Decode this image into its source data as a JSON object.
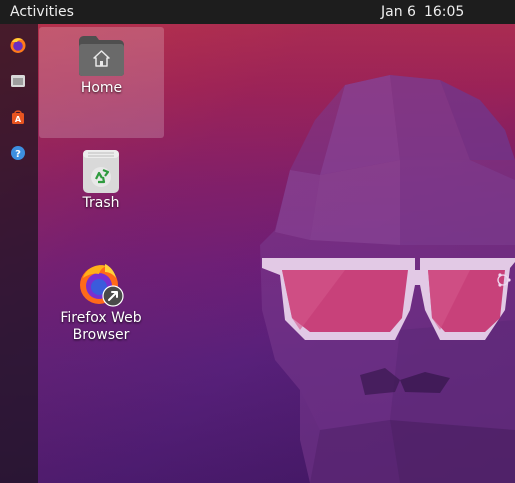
{
  "top_bar": {
    "activities_label": "Activities",
    "date": "Jan 6",
    "time": "16:05"
  },
  "dock": {
    "items": [
      {
        "icon": "firefox-icon"
      },
      {
        "icon": "files-icon"
      },
      {
        "icon": "software-center-icon"
      },
      {
        "icon": "help-icon"
      }
    ]
  },
  "desktop": {
    "icons": [
      {
        "label": "Home",
        "icon": "home-folder-icon",
        "selected": true
      },
      {
        "label": "Trash",
        "icon": "trash-icon",
        "selected": false
      },
      {
        "label": "Firefox Web Browser",
        "icon": "firefox-icon",
        "selected": false
      }
    ]
  },
  "colors": {
    "top_bar": "#1d1d1d",
    "dock": "#1c141e",
    "wallpaper_top": "#b0304f",
    "wallpaper_bottom": "#4b1b6e",
    "glasses": "#c8417a",
    "ubuntu_orange": "#e95420"
  }
}
